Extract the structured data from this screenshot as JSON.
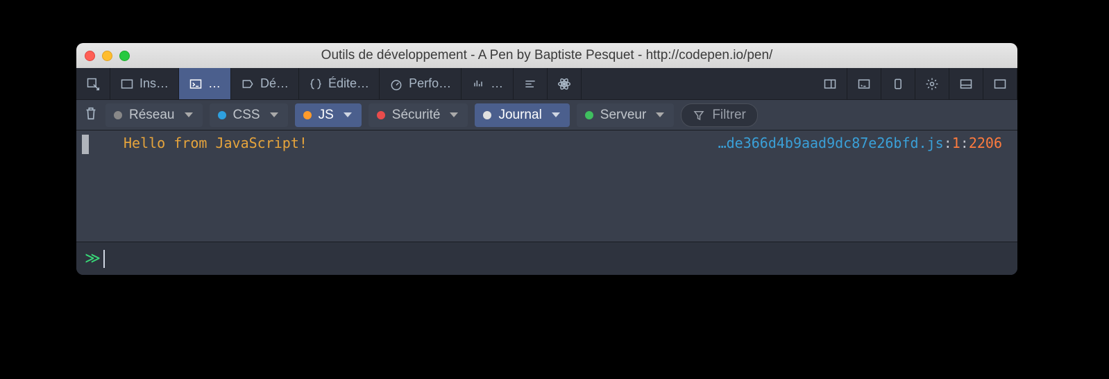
{
  "window": {
    "title": "Outils de développement - A Pen by Baptiste Pesquet - http://codepen.io/pen/"
  },
  "toolbar": {
    "inspect_label": "Ins…",
    "console_label": "…",
    "debug_label": "Dé…",
    "editor_label": "Édite…",
    "perf_label": "Perfo…",
    "memory_label": "…"
  },
  "filters": {
    "reseau": "Réseau",
    "css": "CSS",
    "js": "JS",
    "securite": "Sécurité",
    "journal": "Journal",
    "serveur": "Serveur",
    "filter_placeholder": "Filtrer"
  },
  "log": {
    "message": "Hello from JavaScript!",
    "src_ellipsis": "…",
    "src_file": "de366d4b9aad9dc87e26bfd.js",
    "src_line": "1",
    "src_col": "2206"
  },
  "input": {
    "prompt": "≫"
  }
}
